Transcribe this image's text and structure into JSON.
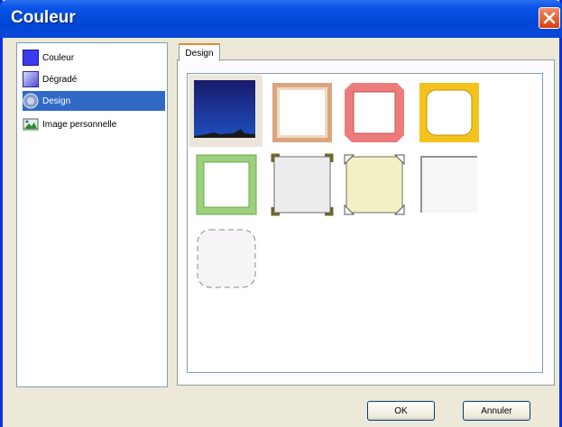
{
  "window": {
    "title": "Couleur"
  },
  "sidebar": {
    "items": [
      {
        "label": "Couleur",
        "icon": "color-swatch-icon"
      },
      {
        "label": "Dégradé",
        "icon": "gradient-icon"
      },
      {
        "label": "Design",
        "icon": "design-icon",
        "selected": true
      },
      {
        "label": "Image personnelle",
        "icon": "image-icon"
      }
    ]
  },
  "tab": {
    "label": "Design"
  },
  "designs": [
    {
      "name": "night-sky",
      "selected": true
    },
    {
      "name": "copper-frame"
    },
    {
      "name": "red-octagon-frame"
    },
    {
      "name": "gold-rounded-frame"
    },
    {
      "name": "green-frame"
    },
    {
      "name": "gray-corner-frame"
    },
    {
      "name": "cream-corner-frame"
    },
    {
      "name": "plain-white-frame"
    },
    {
      "name": "dashed-rounded-frame"
    }
  ],
  "buttons": {
    "ok": "OK",
    "cancel": "Annuler"
  },
  "colors": {
    "accent": "#316ac5",
    "titlebar": "#0046d5",
    "tab_highlight": "#e68b2c"
  }
}
